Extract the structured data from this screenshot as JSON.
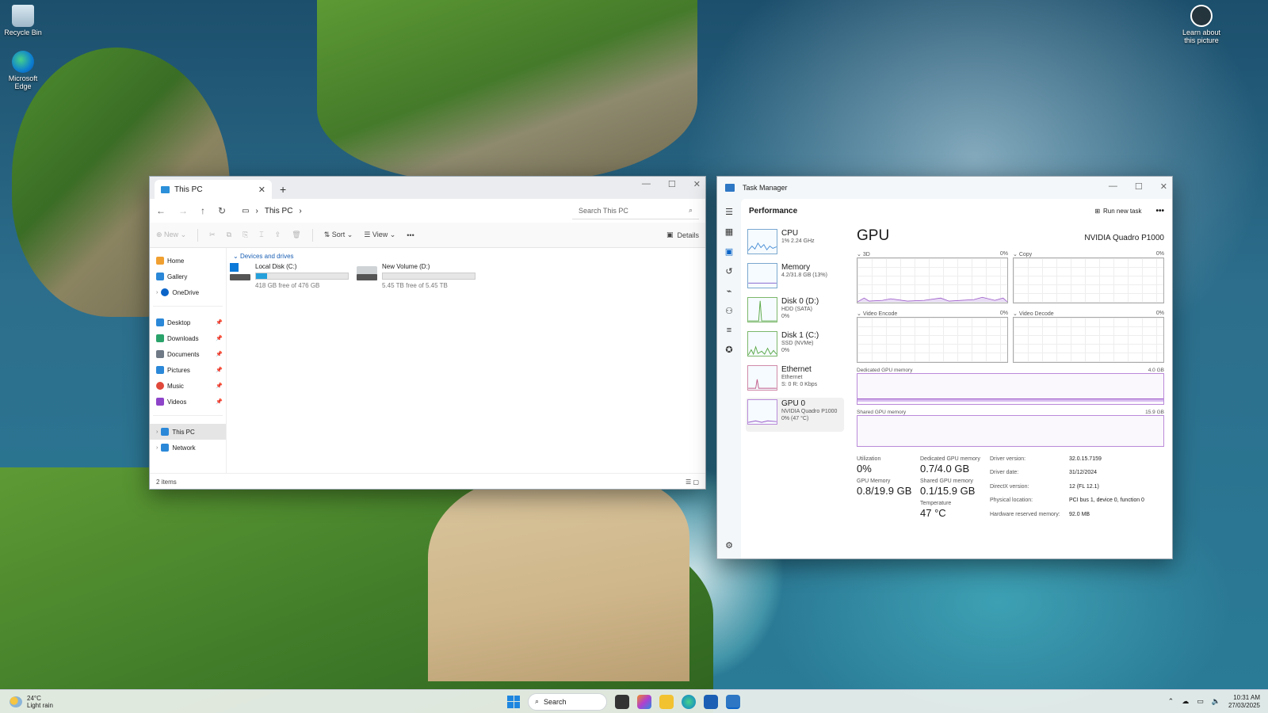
{
  "desktop": {
    "icons": [
      {
        "name": "recycle-bin",
        "label": "Recycle Bin"
      },
      {
        "name": "microsoft-edge",
        "label": "Microsoft Edge"
      },
      {
        "name": "learn-about-picture",
        "label": "Learn about this picture"
      }
    ]
  },
  "explorer": {
    "tab_title": "This PC",
    "new_tab": "+",
    "window_controls": [
      "—",
      "☐",
      "✕"
    ],
    "address": {
      "path": "This PC",
      "search_placeholder": "Search This PC"
    },
    "toolbar": {
      "new": "New",
      "sort": "Sort",
      "view": "View",
      "more": "•••",
      "details": "Details"
    },
    "nav": [
      {
        "label": "Home",
        "icon": "home-icon",
        "color": "#f0a030"
      },
      {
        "label": "Gallery",
        "icon": "gallery-icon",
        "color": "#2b88d8"
      },
      {
        "label": "OneDrive",
        "icon": "onedrive-icon",
        "color": "#0a64c8"
      },
      {
        "label": "Desktop",
        "icon": "desktop-icon",
        "color": "#2b88d8"
      },
      {
        "label": "Downloads",
        "icon": "downloads-icon",
        "color": "#2aa36b"
      },
      {
        "label": "Documents",
        "icon": "documents-icon",
        "color": "#6f7a86"
      },
      {
        "label": "Pictures",
        "icon": "pictures-icon",
        "color": "#2b88d8"
      },
      {
        "label": "Music",
        "icon": "music-icon",
        "color": "#e0483a"
      },
      {
        "label": "Videos",
        "icon": "videos-icon",
        "color": "#8e44c9"
      },
      {
        "label": "This PC",
        "icon": "this-pc-icon",
        "color": "#2b88d8"
      },
      {
        "label": "Network",
        "icon": "network-icon",
        "color": "#2b88d8"
      }
    ],
    "section": "Devices and drives",
    "drives": [
      {
        "name": "Local Disk (C:)",
        "free": "418 GB free of 476 GB",
        "used_fraction": 0.12
      },
      {
        "name": "New Volume (D:)",
        "free": "5.45 TB free of 5.45 TB",
        "used_fraction": 0.0
      }
    ],
    "status": "2 items"
  },
  "taskmanager": {
    "title": "Task Manager",
    "page": "Performance",
    "run_new_task": "Run new task",
    "more": "•••",
    "devices": [
      {
        "name": "CPU",
        "sub1": "1% 2.24 GHz",
        "sub2": "",
        "sub3": ""
      },
      {
        "name": "Memory",
        "sub1": "4.2/31.8 GB (13%)",
        "sub2": "",
        "sub3": ""
      },
      {
        "name": "Disk 0 (D:)",
        "sub1": "HDD (SATA)",
        "sub2": "0%",
        "sub3": ""
      },
      {
        "name": "Disk 1 (C:)",
        "sub1": "SSD (NVMe)",
        "sub2": "0%",
        "sub3": ""
      },
      {
        "name": "Ethernet",
        "sub1": "Ethernet",
        "sub2": "S: 0 R: 0 Kbps",
        "sub3": ""
      },
      {
        "name": "GPU 0",
        "sub1": "NVIDIA Quadro P1000",
        "sub2": "0% (47 °C)",
        "sub3": ""
      }
    ],
    "gpu": {
      "title": "GPU",
      "model": "NVIDIA Quadro P1000",
      "engines": [
        {
          "label": "3D",
          "pct": "0%"
        },
        {
          "label": "Copy",
          "pct": "0%"
        },
        {
          "label": "Video Encode",
          "pct": "0%"
        },
        {
          "label": "Video Decode",
          "pct": "0%"
        }
      ],
      "dedicated_label": "Dedicated GPU memory",
      "dedicated_max": "4.0 GB",
      "shared_label": "Shared GPU memory",
      "shared_max": "15.9 GB",
      "stats": {
        "utilization_label": "Utilization",
        "utilization": "0%",
        "dedicated_label": "Dedicated GPU memory",
        "dedicated": "0.7/4.0 GB",
        "gpu_memory_label": "GPU Memory",
        "gpu_memory": "0.8/19.9 GB",
        "shared_label": "Shared GPU memory",
        "shared": "0.1/15.9 GB",
        "temperature_label": "Temperature",
        "temperature": "47 °C"
      },
      "info": [
        {
          "k": "Driver version:",
          "v": "32.0.15.7159"
        },
        {
          "k": "Driver date:",
          "v": "31/12/2024"
        },
        {
          "k": "DirectX version:",
          "v": "12 (FL 12.1)"
        },
        {
          "k": "Physical location:",
          "v": "PCI bus 1, device 0, function 0"
        },
        {
          "k": "Hardware reserved memory:",
          "v": "92.0 MB"
        }
      ]
    }
  },
  "taskbar": {
    "temp": "24°C",
    "weather": "Light rain",
    "search": "Search",
    "time": "10:31 AM",
    "date": "27/03/2025"
  }
}
